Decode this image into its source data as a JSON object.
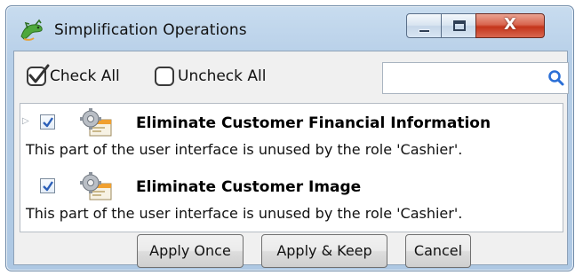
{
  "window": {
    "title": "Simplification Operations",
    "icons": {
      "app": "lizard-icon",
      "minimize": "minimize-icon",
      "maximize": "maximize-icon",
      "close": "close-icon"
    },
    "close_glyph": "X"
  },
  "toolbar": {
    "check_all_label": "Check All",
    "uncheck_all_label": "Uncheck All",
    "search": {
      "value": "",
      "placeholder": "",
      "icon": "search-icon"
    }
  },
  "operations": [
    {
      "checked": true,
      "expandable": true,
      "icon": "gear-window-icon",
      "title": "Eliminate Customer Financial Information",
      "description": "This part of the user interface is unused by the role 'Cashier'."
    },
    {
      "checked": true,
      "expandable": false,
      "icon": "gear-window-icon",
      "title": "Eliminate Customer Image",
      "description": "This part of the user interface is unused by the role 'Cashier'."
    }
  ],
  "buttons": {
    "apply_once": "Apply Once",
    "apply_keep": "Apply & Keep",
    "cancel": "Cancel"
  },
  "colors": {
    "accent": "#2b6fd6",
    "close": "#c4351b",
    "title_bar": "#b7cfe8"
  }
}
